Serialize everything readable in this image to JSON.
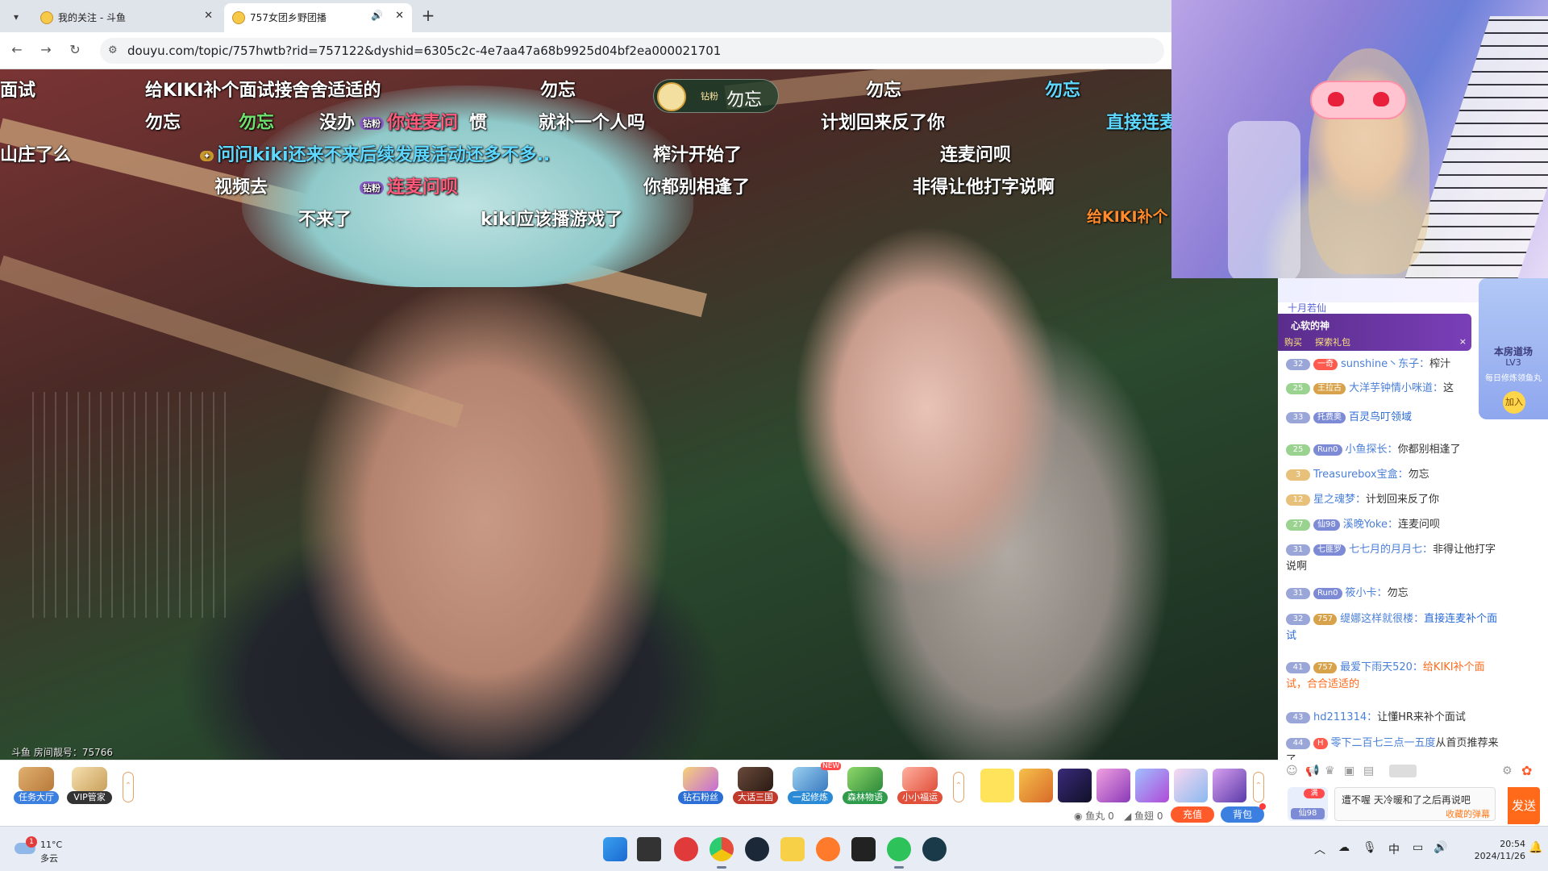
{
  "browser": {
    "tabs": [
      {
        "title": "我的关注 - 斗鱼",
        "active": false
      },
      {
        "title": "757女团乡野团播",
        "active": true
      }
    ],
    "new_tab_label": "+",
    "url": "douyu.com/topic/757hwtb?rid=757122&dyshid=6305c2c-4e7aa47a68b9925d04bf2ea000021701"
  },
  "video": {
    "room_label": "斗鱼 房间靓号：75766",
    "gift_pill": {
      "level": "钻粉",
      "text": "勿忘"
    },
    "danmaku": [
      {
        "text": "面试",
        "color": "white"
      },
      {
        "text": "给KIKI补个面试接舍舍适适的",
        "color": "white"
      },
      {
        "text": "勿忘",
        "color": "white"
      },
      {
        "text": "勿忘",
        "color": "white"
      },
      {
        "text": "勿忘",
        "color": "cyan"
      },
      {
        "text": "勿忘",
        "color": "white"
      },
      {
        "text": "勿忘",
        "color": "green"
      },
      {
        "text": "没办",
        "color": "white"
      },
      {
        "text": "你连麦问",
        "color": "pink"
      },
      {
        "text": "惯",
        "color": "white"
      },
      {
        "text": "就补一个人吗",
        "color": "white"
      },
      {
        "text": "计划回来反了你",
        "color": "white"
      },
      {
        "text": "直接连麦",
        "color": "cyan"
      },
      {
        "text": "山庄了么",
        "color": "white"
      },
      {
        "text": "问问kiki还来不来后续发展活动还多不多..",
        "color": "cyan"
      },
      {
        "text": "榨汁开始了",
        "color": "white"
      },
      {
        "text": "连麦问呗",
        "color": "white"
      },
      {
        "text": "视频去",
        "color": "white"
      },
      {
        "text": "连麦问呗",
        "color": "pink"
      },
      {
        "text": "你都别相逢了",
        "color": "white"
      },
      {
        "text": "非得让他打字说啊",
        "color": "white"
      },
      {
        "text": "给KIKI补个",
        "color": "orange"
      },
      {
        "text": "不来了",
        "color": "white"
      },
      {
        "text": "kiki应该播游戏了",
        "color": "white"
      }
    ]
  },
  "chat": {
    "top_user": "十月若仙",
    "gift_banner": {
      "title": "心软的神",
      "buy": "购买",
      "explore": "探索礼包",
      "close": "×"
    },
    "side_badge": {
      "label": "本房道场",
      "level": "LV3",
      "sub": "每日修炼领鱼丸",
      "join": "加入"
    },
    "messages": [
      {
        "level": "32",
        "fan": "一奇",
        "fan_style": "red",
        "user": "sunshine丶东子：",
        "text": "榨汁",
        "text_style": "normal"
      },
      {
        "level": "25",
        "level_style": "green",
        "fan": "王拉古",
        "fan_style": "gold",
        "user": "大洋芋钟情小咪道：",
        "text": "这",
        "text_style": "normal"
      },
      {
        "level": "33",
        "fan": "托费奥",
        "fan_style": "normal",
        "user": "",
        "text": "百灵鸟叮领域",
        "text_style": "blue"
      },
      {
        "level": "25",
        "level_style": "green",
        "fan": "Run0",
        "fan_style": "normal",
        "user": "小鱼探长：",
        "text": "你都别相逢了",
        "text_style": "normal"
      },
      {
        "level": "3",
        "level_style": "yellow",
        "fan": "",
        "fan_style": "normal",
        "user": "Treasurebox宝盒：",
        "text": "勿忘",
        "text_style": "normal"
      },
      {
        "level": "12",
        "level_style": "yellow",
        "fan": "",
        "fan_style": "normal",
        "user": "星之魂梦：",
        "text": "计划回来反了你",
        "text_style": "normal"
      },
      {
        "level": "27",
        "level_style": "green",
        "fan": "仙98",
        "fan_style": "normal",
        "user": "溪晚Yoke：",
        "text": "连麦问呗",
        "text_style": "normal"
      },
      {
        "level": "31",
        "fan": "七匪罗",
        "fan_style": "normal",
        "user": "七七月的月月七：",
        "text": "非得让他打字说啊",
        "text_style": "normal"
      },
      {
        "level": "31",
        "fan": "Run0",
        "fan_style": "normal",
        "user": "筱小卡：",
        "text": "勿忘",
        "text_style": "normal"
      },
      {
        "level": "32",
        "fan": "757",
        "fan_style": "gold",
        "user": "缇娜这样就很楼：",
        "text": "直接连麦补个面试",
        "text_style": "blue"
      },
      {
        "level": "41",
        "fan": "757",
        "fan_style": "gold",
        "user": "最爱下雨天520：",
        "text": "给KIKI补个面试，合合适适的",
        "text_style": "orange"
      },
      {
        "level": "43",
        "fan": "",
        "fan_style": "normal",
        "user": "hd211314：",
        "text": "让懂HR来补个面试",
        "text_style": "normal"
      },
      {
        "level": "44",
        "fan": "H",
        "fan_style": "red",
        "user": "零下二百七三点一五度",
        "text": "从首页推荐来了",
        "text_style": "normal"
      }
    ],
    "input": {
      "placeholder": "遭不喔 天冷暖和了之后再说吧",
      "fav_danmaku": "收藏的弹幕",
      "send_label": "发送",
      "user_tag": "仙98",
      "user_hot": "满"
    }
  },
  "toolbar": {
    "left_items": [
      {
        "label": "任务大厅",
        "color": "#3b7fe0"
      },
      {
        "label": "VIP管家",
        "color": "#333333"
      }
    ],
    "apps": [
      {
        "label": "钻石粉丝",
        "color": "#2b6fd6"
      },
      {
        "label": "大话三国",
        "color": "#c0392b"
      },
      {
        "label": "一起修炼",
        "color": "#2b8ad6"
      },
      {
        "label": "森林物语",
        "color": "#2e9c4a"
      },
      {
        "label": "小小福运",
        "color": "#e0503b"
      }
    ],
    "new_badge": "NEW",
    "more_glyph": "⌃",
    "balances": [
      {
        "label": "鱼丸",
        "value": "0"
      },
      {
        "label": "鱼翅",
        "value": "0"
      }
    ],
    "recharge_label": "充值",
    "bag_label": "背包"
  },
  "taskbar": {
    "weather": {
      "temp": "11°C",
      "condition": "多云",
      "badge": "1"
    },
    "tray": {
      "ime": "中"
    },
    "time": "20:54",
    "date": "2024/11/26"
  }
}
